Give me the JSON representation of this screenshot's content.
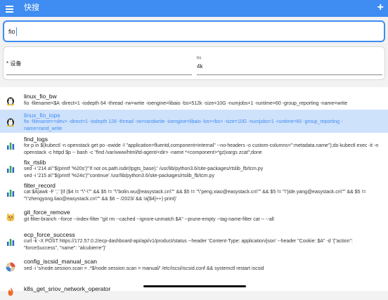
{
  "header": {
    "title": "快搜",
    "add_label": "+"
  },
  "search": {
    "value": "fio"
  },
  "params": {
    "device": {
      "label": "* 设备",
      "value": ""
    },
    "bs": {
      "label": "bs",
      "value": "4k"
    }
  },
  "items": [
    {
      "name": "linux_fio_bw",
      "cmd": "fio -filename=$A -direct=1 -iodepth 64 -thread -rw=write -ioengine=libaio -bs=512k -size=10G -numjobs=1 -runtime=60 -group_reporting -name=write",
      "icon": "linux-penguin-icon"
    },
    {
      "name": "linux_fio_iops",
      "cmd": "fio -filename=<dev> -direct=1 -iodepth 128 -thread -rw=randwrite -ioengine=libaio -bs=<bs> -size=10G -numjobs=1 -runtime=60 -group_reporting -name=rand_write",
      "icon": "linux-penguin-icon"
    },
    {
      "name": "find_logs",
      "cmd": "for p in $(kubectl -n openstack get po -owide -l \"application=fluentd,component=internal\" --no-headers -o custom-columns=\":metadata.name\");do kubectl exec -it -n openstack -c httpd $p -- bash -c \"find /var/www/html/td-agent/<dir> -name *<component>*gz|xargs zcat\";done",
      "icon": "bar-chart-icon"
    },
    {
      "name": "fix_rtslib",
      "cmd": "sed -i '214 a\\'\"$(printf '%20s')\"'if not os.path.isdir(tpgts_base):' /usr/lib/python3.6/site-packages/rtslib_fb/tcm.py\nsed -i '215 a\\'\"$(printf '%24s')\"'continue' /usr/lib/python3.6/site-packages/rtslib_fb/tcm.py",
      "icon": "bar-chart-icon"
    },
    {
      "name": "filter_record",
      "cmd": "cat $A|awk -F ',' '{if ($4 != \"\\\"-\\\"\" && $5 != \"\\\"bolin.wu@easystack.cn\\\"\" && $5 != \"\\\"peng.xiao@easystack.cn\\\"\" && $5 != \"\\\"jide.yang@easystack.cn\\\"\" && $5 != \"\\\"zhengyong.liao@easystack.cn\\\"\" && $6 ~ /2023/ && !a[$4]++) print}'",
      "icon": "bar-chart-icon"
    },
    {
      "name": "git_force_remove",
      "cmd": "git filter-branch --force --index-filter \"git rm --cached --ignore-unmatch $A\" --prune-empty --tag-name-filter cat -- --all",
      "icon": "git-cat-icon"
    },
    {
      "name": "ecp_force_success",
      "cmd": "curl -k -X POST https://172.57.0.2/ecp-dashboard-api/api/v1/product/status --header 'Content-Type: application/json' --header \"Cookie: $A\" -d '{\"action\": \"forceSuccess\", \"name\": \"alcubierre\"}'",
      "icon": "bar-chart-icon"
    },
    {
      "name": "config_iscsid_manual_scan",
      "cmd": "sed -i 's/node.session.scan = .*$/node.session.scan = manual/' /etc/iscsi/iscsid.conf && systemctl restart iscsid",
      "icon": "disc-icon"
    },
    {
      "name": "k8s_get_sriov_network_operator",
      "cmd": "",
      "icon": "fire-icon"
    }
  ],
  "colors": {
    "accent": "#3f8cf2",
    "selected_bg": "#cfe2fb"
  }
}
